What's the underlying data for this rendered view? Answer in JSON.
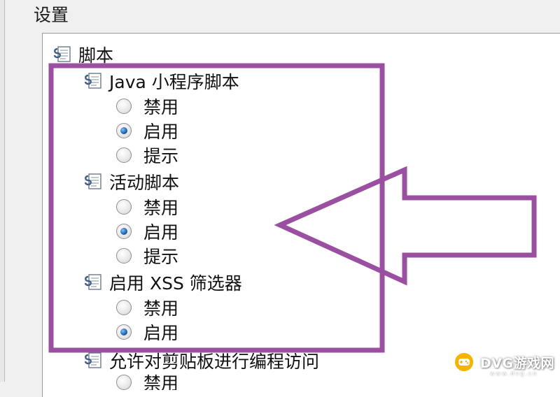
{
  "group": {
    "title": "设置"
  },
  "tree": {
    "root": {
      "label": "脚本",
      "icon": "script-doc-icon"
    },
    "sections": [
      {
        "label": "Java 小程序脚本",
        "icon": "script-doc-icon",
        "options": [
          {
            "label": "禁用",
            "checked": false
          },
          {
            "label": "启用",
            "checked": true
          },
          {
            "label": "提示",
            "checked": false
          }
        ]
      },
      {
        "label": "活动脚本",
        "icon": "script-doc-icon",
        "options": [
          {
            "label": "禁用",
            "checked": false
          },
          {
            "label": "启用",
            "checked": true
          },
          {
            "label": "提示",
            "checked": false
          }
        ]
      },
      {
        "label": "启用 XSS 筛选器",
        "icon": "script-doc-icon",
        "options": [
          {
            "label": "禁用",
            "checked": false
          },
          {
            "label": "启用",
            "checked": true
          }
        ]
      },
      {
        "label": "允许对剪贴板进行编程访问",
        "icon": "script-doc-icon",
        "options": [
          {
            "label": "禁用",
            "checked": false
          }
        ]
      }
    ]
  },
  "annotation": {
    "color": "#9b4fa0",
    "shapes": [
      "highlight-rectangle",
      "arrow-left"
    ]
  },
  "watermark": {
    "text": "DVG游戏网",
    "subtext": "www.dvg.cn",
    "icon": "gamepad-icon"
  }
}
